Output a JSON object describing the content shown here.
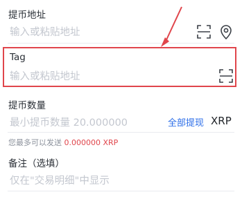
{
  "address": {
    "label": "提币地址",
    "placeholder": "输入或粘贴地址",
    "scan_icon": "scan-icon",
    "location_icon": "location-pin-icon"
  },
  "tag": {
    "label": "Tag",
    "placeholder": "输入或粘贴地址",
    "scan_icon": "scan-icon"
  },
  "amount": {
    "label": "提币数量",
    "placeholder": "最小提币数量 20.000000",
    "withdraw_all": "全部提现",
    "currency": "XRP",
    "hint_prefix": "您最多可以发送",
    "hint_amount": "0.000000 XRP"
  },
  "memo": {
    "label": "备注（选填）",
    "placeholder": "仅在\"交易明细\"中显示"
  },
  "colors": {
    "accent": "#2b6de8",
    "highlight": "#e0454b"
  }
}
